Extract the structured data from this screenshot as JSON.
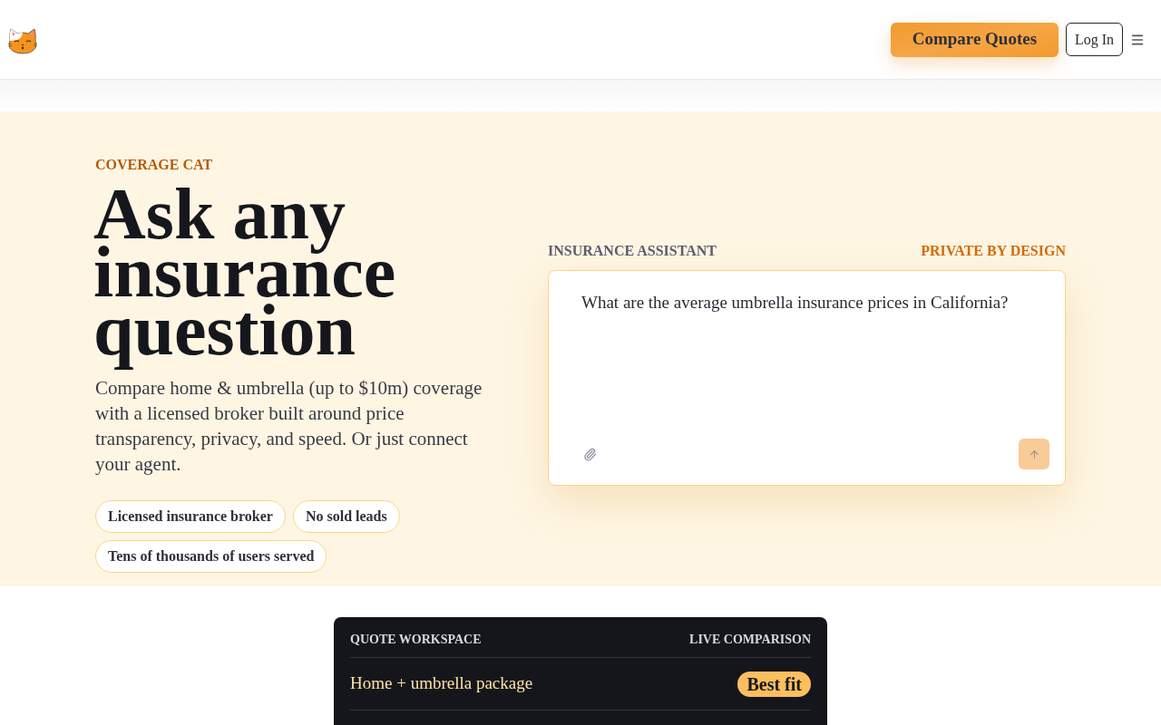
{
  "header": {
    "compare_button": "Compare Quotes",
    "login_button": "Log In"
  },
  "hero": {
    "eyebrow": "COVERAGE CAT",
    "headline": "Ask any insurance question",
    "description": "Compare home & umbrella (up to $10m) coverage with a licensed broker built around price transparency, privacy, and speed. Or just connect your agent.",
    "pills": [
      "Licensed insurance broker",
      "No sold leads",
      "Tens of thousands of users served"
    ]
  },
  "assistant": {
    "label": "INSURANCE ASSISTANT",
    "badge": "PRIVATE BY DESIGN",
    "question": {
      "value": "What are the average umbrella insurance prices in California?"
    }
  },
  "workspace": {
    "title": "QUOTE WORKSPACE",
    "status": "LIVE COMPARISON",
    "rows": [
      {
        "name": "Home + umbrella package",
        "tag": "Best fit"
      }
    ]
  }
}
